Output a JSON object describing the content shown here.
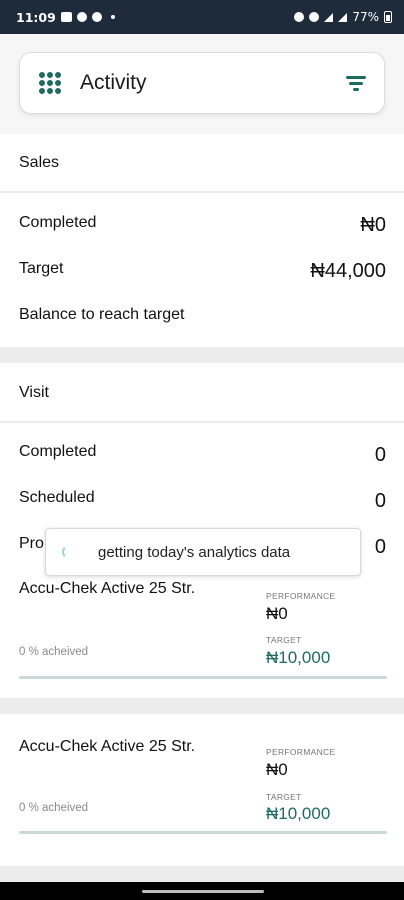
{
  "status_bar": {
    "time": "11:09",
    "battery": "77%"
  },
  "header": {
    "title": "Activity"
  },
  "sales": {
    "title": "Sales",
    "rows": [
      {
        "label": "Completed",
        "value": "₦0"
      },
      {
        "label": "Target",
        "value": "₦44,000"
      },
      {
        "label": "Balance to reach target",
        "value": ""
      }
    ]
  },
  "visit": {
    "title": "Visit",
    "rows": [
      {
        "label": "Completed",
        "value": "0"
      },
      {
        "label": "Scheduled",
        "value": "0"
      },
      {
        "label": "Pro",
        "value": "0"
      }
    ]
  },
  "products": [
    {
      "name": "Accu-Chek Active 25 Str.",
      "performance_label": "PERFORMANCE",
      "performance": "₦0",
      "target_label": "TARGET",
      "target": "₦10,000",
      "achieved": "0 % acheived",
      "progress": 0
    },
    {
      "name": "Accu-Chek Active 25 Str.",
      "performance_label": "PERFORMANCE",
      "performance": "₦0",
      "target_label": "TARGET",
      "target": "₦10,000",
      "achieved": "0 % acheived",
      "progress": 0
    }
  ],
  "toast": {
    "message": "getting today's analytics data"
  },
  "colors": {
    "accent": "#1e6b61",
    "status_bar": "#1e2b3a"
  }
}
